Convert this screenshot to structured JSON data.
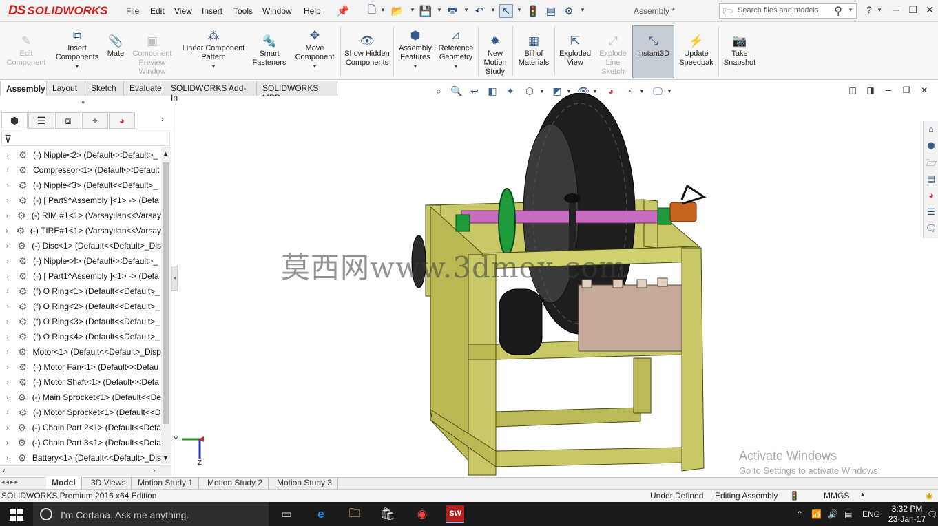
{
  "app": {
    "logo_ds": "DS",
    "logo_text": "SOLIDWORKS",
    "doc_title": "Assembly *"
  },
  "menu": [
    "File",
    "Edit",
    "View",
    "Insert",
    "Tools",
    "Window",
    "Help"
  ],
  "search": {
    "placeholder": "Search files and models"
  },
  "ribbon": [
    {
      "label": "Edit Component",
      "icon": "edit-component-icon",
      "enabled": false
    },
    {
      "label": "Insert Components",
      "icon": "insert-components-icon",
      "enabled": true
    },
    {
      "label": "Mate",
      "icon": "mate-icon",
      "enabled": true
    },
    {
      "label": "Component Preview Window",
      "icon": "preview-window-icon",
      "enabled": false
    },
    {
      "label": "Linear Component Pattern",
      "icon": "pattern-icon",
      "enabled": true
    },
    {
      "label": "Smart Fasteners",
      "icon": "smart-fasteners-icon",
      "enabled": true
    },
    {
      "label": "Move Component",
      "icon": "move-component-icon",
      "enabled": true
    },
    {
      "label": "Show Hidden Components",
      "icon": "show-hidden-icon",
      "enabled": true
    },
    {
      "label": "Assembly Features",
      "icon": "assembly-features-icon",
      "enabled": true
    },
    {
      "label": "Reference Geometry",
      "icon": "reference-geometry-icon",
      "enabled": true
    },
    {
      "label": "New Motion Study",
      "icon": "motion-study-icon",
      "enabled": true
    },
    {
      "label": "Bill of Materials",
      "icon": "bom-icon",
      "enabled": true
    },
    {
      "label": "Exploded View",
      "icon": "exploded-view-icon",
      "enabled": true
    },
    {
      "label": "Explode Line Sketch",
      "icon": "explode-line-icon",
      "enabled": false
    },
    {
      "label": "Instant3D",
      "icon": "instant3d-icon",
      "enabled": true,
      "active": true
    },
    {
      "label": "Update Speedpak",
      "icon": "speedpak-icon",
      "enabled": true
    },
    {
      "label": "Take Snapshot",
      "icon": "camera-icon",
      "enabled": true
    }
  ],
  "tabs": [
    "Assembly",
    "Layout",
    "Sketch",
    "Evaluate",
    "SOLIDWORKS Add-Ins",
    "SOLIDWORKS MBD"
  ],
  "tree": [
    "(-) Nipple<2> (Default<<Default>_",
    "Compressor<1> (Default<<Default",
    "(-) Nipple<3> (Default<<Default>_",
    "(-) [ Part9^Assembly ]<1> -> (Defa",
    "(-) RIM #1<1> (Varsayılan<<Varsay",
    "(-) TIRE#1<1> (Varsayılan<<Varsay",
    "(-) Disc<1> (Default<<Default>_Dis",
    "(-) Nipple<4> (Default<<Default>_",
    "(-) [ Part1^Assembly ]<1> -> (Defa",
    "(f) O Ring<1> (Default<<Default>_",
    "(f) O Ring<2> (Default<<Default>_",
    "(f) O Ring<3> (Default<<Default>_",
    "(f) O Ring<4> (Default<<Default>_",
    "Motor<1> (Default<<Default>_Disp",
    "(-) Motor Fan<1> (Default<<Defau",
    "(-) Motor Shaft<1> (Default<<Defa",
    "(-) Main Sprocket<1> (Default<<De",
    "(-) Motor Sprocket<1> (Default<<D",
    "(-) Chain Part 2<1> (Default<<Defa",
    "(-) Chain Part 3<1> (Default<<Defa",
    "Battery<1> (Default<<Default>_Dis"
  ],
  "watermark": "莫西网www.3dmox.com",
  "activate": {
    "title": "Activate Windows",
    "sub": "Go to Settings to activate Windows."
  },
  "bottom_tabs": [
    "Model",
    "3D Views",
    "Motion Study 1",
    "Motion Study 2",
    "Motion Study 3"
  ],
  "status": {
    "edition": "SOLIDWORKS Premium 2016 x64 Edition",
    "defined": "Under Defined",
    "mode": "Editing Assembly",
    "units": "MMGS"
  },
  "triad": {
    "y": "Y",
    "z": "Z"
  },
  "taskbar": {
    "cortana": "I'm Cortana. Ask me anything.",
    "time": "3:32 PM",
    "date": "23-Jan-17",
    "lang": "ENG"
  },
  "colors": {
    "frame": "#c9c866",
    "frame_dark": "#8e8c2e",
    "axle": "#c86cc0",
    "sprocket": "#1f9a3a",
    "battery": "#c5a99a",
    "accent": "#d71a1a"
  }
}
